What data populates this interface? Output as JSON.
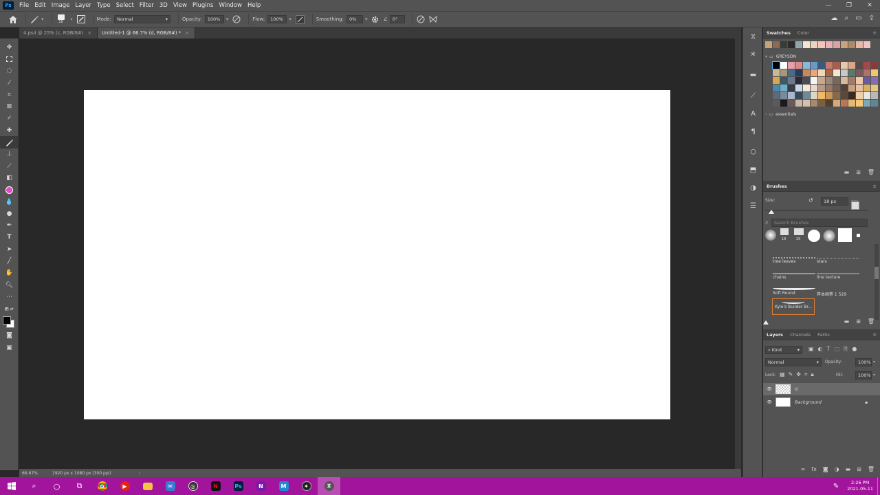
{
  "app": {
    "logo": "Ps"
  },
  "menu": [
    "File",
    "Edit",
    "Image",
    "Layer",
    "Type",
    "Select",
    "Filter",
    "3D",
    "View",
    "Plugins",
    "Window",
    "Help"
  ],
  "window_controls": {
    "minimize": "—",
    "restore": "❐",
    "close": "✕"
  },
  "options": {
    "brush_size": "18",
    "mode_label": "Mode:",
    "mode_value": "Normal",
    "opacity_label": "Opacity:",
    "opacity_value": "100%",
    "flow_label": "Flow:",
    "flow_value": "100%",
    "smoothing_label": "Smoothing:",
    "smoothing_value": "0%",
    "angle_value": "0°"
  },
  "tabs": [
    {
      "label": "4.psd @ 25% (c, RGB/8#)",
      "active": false
    },
    {
      "label": "Untitled-1 @ 66.7% (d, RGB/8#) *",
      "active": true
    }
  ],
  "status": {
    "zoom": "66.67%",
    "doc_info": "1920 px x 1080 px (300 ppi)"
  },
  "swatches": {
    "tabs": [
      "Swatches",
      "Color"
    ],
    "group_greyson": "GREYSON",
    "group_essentials": "essentials",
    "recent": [
      "#c8a27a",
      "#8b6a50",
      "#3a3a3a",
      "#2b2b2b",
      "#8fa6a8",
      "#f2e4d0",
      "#e9d5c0",
      "#f3c6b8",
      "#e8b4b8",
      "#d9a3a0",
      "#c9a27e",
      "#b08a68",
      "#e6b8a8",
      "#f0c4c0"
    ],
    "greyson": [
      "#000000",
      "#ffffff",
      "#e8a0a8",
      "#d98a8a",
      "#8ab8d8",
      "#6a98c8",
      "#3a5a7a",
      "#c87a6a",
      "#b05a4a",
      "#e8c8a8",
      "#d8a888",
      "#5a4a4a",
      "#a04a4a",
      "#8a3a3a",
      "#c8b898",
      "#a89878",
      "#4a6a8a",
      "#2a3a5a",
      "#c88a5a",
      "#e8a878",
      "#f0d8b8",
      "#a86848",
      "#f5e6d0",
      "#c8c8c8",
      "#5a7a6a",
      "#7a5a5a",
      "#b07070",
      "#e8c870",
      "#d8a850",
      "#3a5a6a",
      "#6a7a8a",
      "#2a2a3a",
      "#4a4a5a",
      "#f5f5f5",
      "#c8a888",
      "#988878",
      "#786858",
      "#d8b898",
      "#a87868",
      "#f0c8a8",
      "#6a5aa0",
      "#8a6ab8",
      "#4a8aa8",
      "#6ab0c8",
      "#3a3a4a",
      "#c8d8e8",
      "#f8e8d8",
      "#e8d8c8",
      "#b89888",
      "#987868",
      "#786050",
      "#5a4030",
      "#c8a080",
      "#e8c0a0",
      "#d8b060",
      "#e8c880",
      "#5a6a7a",
      "#7a8a9a",
      "#a8b8c8",
      "#384858",
      "#6a8a9a",
      "#d8d8c8",
      "#f0b868",
      "#c89858",
      "#8a6848",
      "#5a4838",
      "#3a2a20",
      "#f0d0a8",
      "#e8e8e0",
      "#b8b8b8",
      "#5a5a5a",
      "#1a1a1a",
      "#6a5a5a",
      "#c8b8a8",
      "#d8c0a8",
      "#a88870",
      "#786048",
      "#504030",
      "#d8a878",
      "#b87858",
      "#e8b870",
      "#f8c878",
      "#7aa8b8",
      "#5a8898"
    ]
  },
  "brushes": {
    "title": "Brushes",
    "size_label": "Size:",
    "size_value": "18 px",
    "search_placeholder": "Search Brushes",
    "preset_sizes": [
      "18",
      "29"
    ],
    "items": [
      "tree leaves",
      "stars",
      "chains",
      "line texture",
      "Soft Round",
      "笄本画笔 1 529",
      "Kyle's Builder Br..."
    ]
  },
  "layers": {
    "tabs": [
      "Layers",
      "Channels",
      "Paths"
    ],
    "kind_label": "Kind",
    "blend": "Normal",
    "opacity_label": "Opacity:",
    "opacity_value": "100%",
    "lock_label": "Lock:",
    "fill_label": "Fill:",
    "fill_value": "100%",
    "list": [
      {
        "name": "d"
      },
      {
        "name": "Background"
      }
    ]
  },
  "taskbar": {
    "time": "2:26 PM",
    "date": "2021-05-11"
  }
}
